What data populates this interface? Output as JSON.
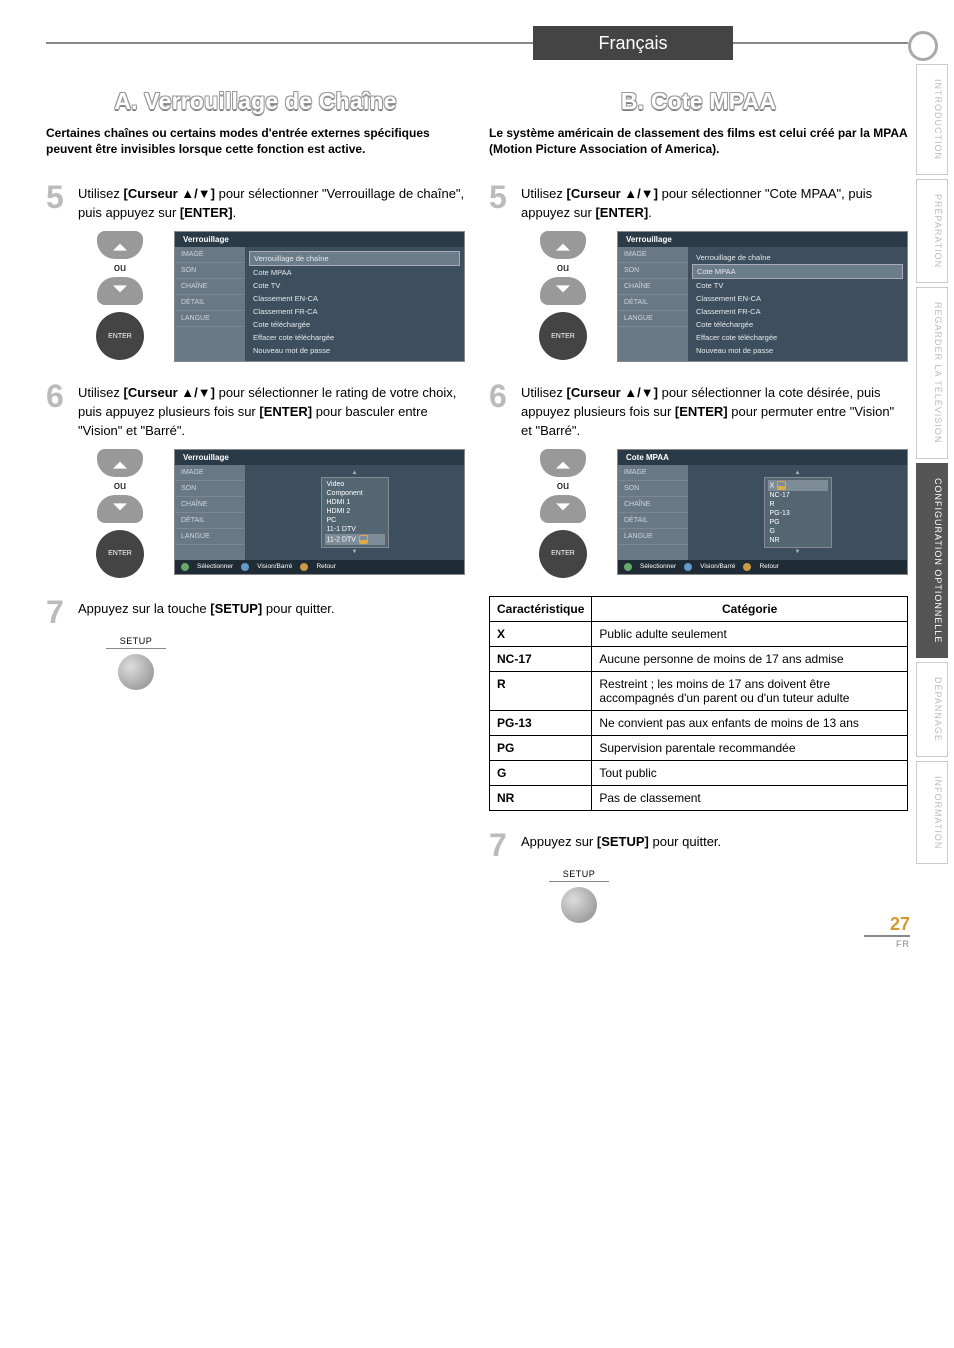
{
  "lang_tab": "Français",
  "side_tabs": [
    "INTRODUCTION",
    "PRÉPARATION",
    "REGARDER LA\nTÉLÉVISION",
    "CONFIGURATION\nOPTIONNELLE",
    "DÉPANNAGE",
    "INFORMATION"
  ],
  "side_tab_active_index": 3,
  "page_number": "27",
  "page_lang_code": "FR",
  "A": {
    "title": "A. Verrouillage de Chaîne",
    "intro": "Certaines chaînes ou certains modes d'entrée externes spécifiques peuvent être invisibles lorsque cette fonction est active.",
    "step5": {
      "num": "5",
      "pre": "Utilisez ",
      "bold1": "[Curseur ▲/▼]",
      "mid": " pour sélectionner \"Verrouillage de chaîne\", puis appuyez sur ",
      "bold2": "[ENTER]",
      "post": "."
    },
    "remote": {
      "ou": "ou",
      "enter": "ENTER"
    },
    "osd5": {
      "title": "Verrouillage",
      "left": [
        "IMAGE",
        "SON",
        "CHAÎNE",
        "DÉTAIL",
        "LANGUE"
      ],
      "rows": [
        "Verrouillage de chaîne",
        "Cote MPAA",
        "Cote TV",
        "Classement EN-CA",
        "Classement FR-CA",
        "Cote téléchargée",
        "Effacer cote téléchargée",
        "Nouveau mot de passe"
      ],
      "sel_index": 0
    },
    "step6": {
      "num": "6",
      "pre": "Utilisez ",
      "bold1": "[Curseur ▲/▼]",
      "mid1": " pour sélectionner le rating de votre choix, puis appuyez plusieurs fois sur ",
      "bold2": "[ENTER]",
      "mid2": " pour basculer entre \"Vision\" et \"Barré\"."
    },
    "osd6": {
      "title": "Verrouillage",
      "left": [
        "IMAGE",
        "SON",
        "CHAÎNE",
        "DÉTAIL",
        "LANGUE"
      ],
      "panel_rows": [
        "Video",
        "Component",
        "HDMI 1",
        "HDMI 2",
        "PC",
        "11-1 DTV",
        "11-2 DTV"
      ],
      "hl_index": 6,
      "footer": [
        "Sélectionner",
        "Vision/Barré",
        "Retour"
      ]
    },
    "step7": {
      "num": "7",
      "pre": "Appuyez sur la touche ",
      "bold1": "[SETUP]",
      "post": " pour quitter."
    },
    "setup_label": "SETUP"
  },
  "B": {
    "title": "B. Cote MPAA",
    "intro": "Le système américain de classement des films est celui créé par la MPAA (Motion Picture Association of America).",
    "step5": {
      "num": "5",
      "pre": "Utilisez ",
      "bold1": "[Curseur ▲/▼]",
      "mid": " pour sélectionner \"Cote MPAA\", puis appuyez sur ",
      "bold2": "[ENTER]",
      "post": "."
    },
    "remote": {
      "ou": "ou",
      "enter": "ENTER"
    },
    "osd5": {
      "title": "Verrouillage",
      "left": [
        "IMAGE",
        "SON",
        "CHAÎNE",
        "DÉTAIL",
        "LANGUE"
      ],
      "rows": [
        "Verrouillage de chaîne",
        "Cote MPAA",
        "Cote TV",
        "Classement EN-CA",
        "Classement FR-CA",
        "Cote téléchargée",
        "Effacer cote téléchargée",
        "Nouveau mot de passe"
      ],
      "sel_index": 1
    },
    "step6": {
      "num": "6",
      "pre": "Utilisez ",
      "bold1": "[Curseur ▲/▼]",
      "mid1": " pour sélectionner la cote désirée, puis appuyez plusieurs fois sur ",
      "bold2": "[ENTER]",
      "mid2": " pour permuter entre \"Vision\" et \"Barré\"."
    },
    "osd6": {
      "title": "Cote MPAA",
      "left": [
        "IMAGE",
        "SON",
        "CHAÎNE",
        "DÉTAIL",
        "LANGUE"
      ],
      "panel_rows": [
        "X",
        "NC-17",
        "R",
        "PG-13",
        "PG",
        "G",
        "NR"
      ],
      "hl_index": 0,
      "footer": [
        "Sélectionner",
        "Vision/Barré",
        "Retour"
      ]
    },
    "table": {
      "head": [
        "Caractéristique",
        "Catégorie"
      ],
      "rows": [
        [
          "X",
          "Public adulte seulement"
        ],
        [
          "NC-17",
          "Aucune personne de moins de 17 ans admise"
        ],
        [
          "R",
          "Restreint ; les moins de 17 ans doivent être accompagnés d'un parent ou d'un tuteur adulte"
        ],
        [
          "PG-13",
          "Ne convient pas aux enfants de moins de 13 ans"
        ],
        [
          "PG",
          "Supervision parentale recommandée"
        ],
        [
          "G",
          "Tout public"
        ],
        [
          "NR",
          "Pas de classement"
        ]
      ]
    },
    "step7": {
      "num": "7",
      "pre": "Appuyez sur ",
      "bold1": "[SETUP]",
      "post": " pour quitter."
    },
    "setup_label": "SETUP"
  }
}
